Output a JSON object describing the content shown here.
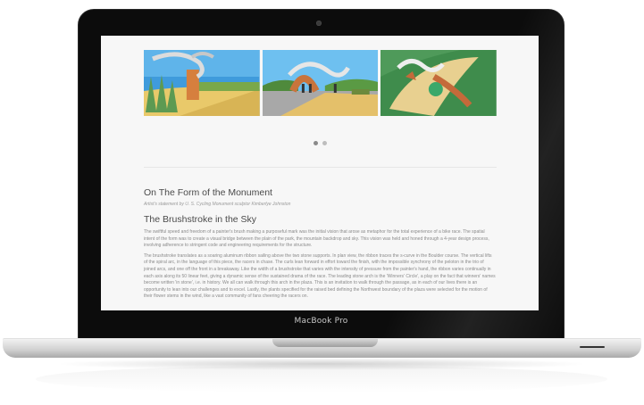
{
  "device": {
    "brand_label": "MacBook Pro"
  },
  "gallery": {
    "images": [
      {
        "alt": "sky-rendering-reeds-and-ribbon-arch"
      },
      {
        "alt": "ribbon-arch-over-plaza-with-figures"
      },
      {
        "alt": "aerial-view-of-s-curve-ribbon-and-stones"
      }
    ],
    "pager": {
      "count": 2,
      "active_index": 0
    }
  },
  "article": {
    "title": "On The Form of the Monument",
    "byline": "Artist's statement by U. S. Cycling Monument sculptor Kimberlye Johnston",
    "subtitle": "The Brushstroke in the Sky",
    "paragraph_1": "The swiftful speed and freedom of a painter's brush making a purposeful mark was the initial vision that arose as metaphor for the total experience of a bike race. The spatial intent of the form was to create a visual bridge between the plain of the park, the mountain backdrop and sky. This vision was held and honed through a 4-year design process, involving adherence to stringent code and engineering requirements for the structure.",
    "paragraph_2": "The brushstroke translates as a soaring aluminum ribbon sailing above the two stone supports. In plan view, the ribbon traces the s-curve in the Boulder course. The vertical lifts of the spiral arc, in the language of this piece, the racers in chase. The curls lean forward in effort toward the finish, with the impossible synchrony of the peloton in the trio of joined arcs, and one off the front in a breakaway. Like the width of a brushstroke that varies with the intensity of pressure from the painter's hand, the ribbon varies continually in each axis along its 50 linear feet, giving a dynamic sense of the sustained drama of the race. The leading stone arch is the 'Winners' Circle', a play on the fact that winners' names become written 'in stone', i.e. in history. We all can walk through this arch in the plaza. This is an invitation to walk through the passage, as in each of our lives there is an opportunity to lean into our challenges and to excel. Lastly, the plants specified for the raised bed defining the Northwest boundary of the plaza were selected for the motion of their flower stems in the wind, like a vast community of fans cheering the racers on."
  },
  "colors": {
    "page_bg": "#f7f7f7",
    "heading": "#4a4a4a",
    "body_text": "#8a8a8a",
    "bezel": "#0c0c0c"
  }
}
